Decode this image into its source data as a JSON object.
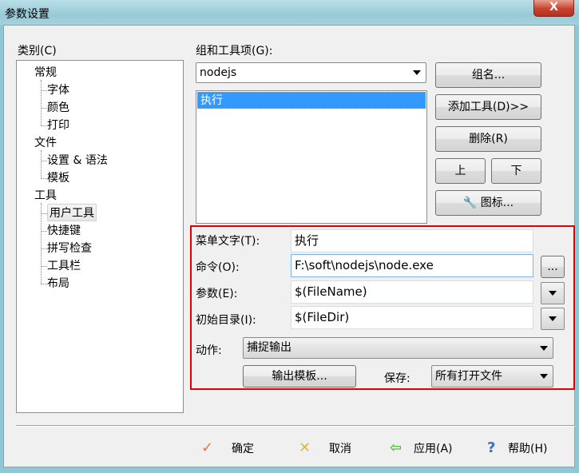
{
  "window": {
    "title": "参数设置",
    "close": "X"
  },
  "category": {
    "label": "类别(C)",
    "items": [
      {
        "label": "常规",
        "level": 0
      },
      {
        "label": "字体",
        "level": 1
      },
      {
        "label": "颜色",
        "level": 1
      },
      {
        "label": "打印",
        "level": 1
      },
      {
        "label": "文件",
        "level": 0
      },
      {
        "label": "设置 & 语法",
        "level": 1
      },
      {
        "label": "模板",
        "level": 1
      },
      {
        "label": "工具",
        "level": 0
      },
      {
        "label": "用户工具",
        "level": 1,
        "selected": true
      },
      {
        "label": "快捷键",
        "level": 1
      },
      {
        "label": "拼写检查",
        "level": 1
      },
      {
        "label": "工具栏",
        "level": 1
      },
      {
        "label": "布局",
        "level": 1
      }
    ]
  },
  "group": {
    "label": "组和工具项(G):",
    "selected": "nodejs",
    "list": [
      "执行"
    ]
  },
  "buttons": {
    "group_name": "组名...",
    "add_tool": "添加工具(D)>>",
    "delete": "删除(R)",
    "up": "上",
    "down": "下",
    "icon": "图标..."
  },
  "fields": {
    "menu_text": {
      "label": "菜单文字(T):",
      "value": "执行"
    },
    "command": {
      "label": "命令(O):",
      "value": "F:\\soft\\nodejs\\node.exe",
      "browse": "..."
    },
    "args": {
      "label": "参数(E):",
      "value": "$(FileName)"
    },
    "init_dir": {
      "label": "初始目录(I):",
      "value": "$(FileDir)"
    },
    "action": {
      "label": "动作:",
      "value": "捕捉输出"
    },
    "output_template": "输出模板...",
    "save": {
      "label": "保存:",
      "value": "所有打开文件"
    }
  },
  "footer": {
    "ok": "确定",
    "cancel": "取消",
    "apply": "应用(A)",
    "help": "帮助(H)"
  },
  "colors": {
    "highlight": "#e00000",
    "selection": "#3399ff"
  }
}
